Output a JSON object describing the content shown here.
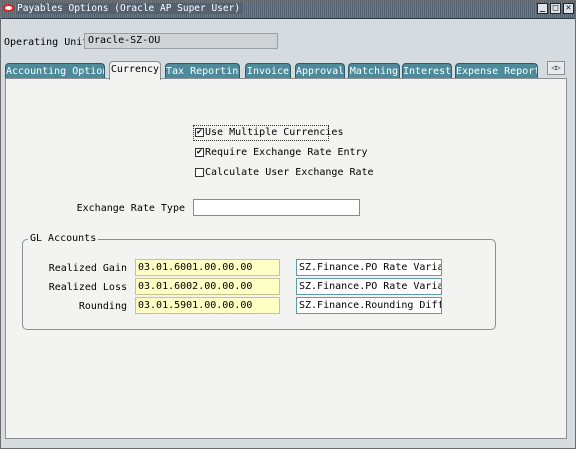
{
  "window": {
    "title": "Payables Options (Oracle AP Super User)",
    "buttons": [
      "_",
      "□",
      "✕"
    ]
  },
  "operating_unit": {
    "label": "Operating Unit",
    "value": "Oracle-SZ-OU"
  },
  "tabs": [
    {
      "label": "Accounting Option",
      "active": false
    },
    {
      "label": "Currency",
      "active": true
    },
    {
      "label": "Tax Reporting",
      "active": false
    },
    {
      "label": "Invoice",
      "active": false
    },
    {
      "label": "Approval",
      "active": false
    },
    {
      "label": "Matching",
      "active": false
    },
    {
      "label": "Interest",
      "active": false
    },
    {
      "label": "Expense Report",
      "active": false
    }
  ],
  "tab_scroll_icon": "◁▷",
  "options": {
    "use_multiple_currencies": {
      "label": "Use Multiple Currencies",
      "checked": true,
      "mark": "✔"
    },
    "require_exchange_rate_entry": {
      "label": "Require Exchange Rate Entry",
      "checked": true,
      "mark": "✔"
    },
    "calculate_user_exchange_rate": {
      "label": "Calculate User Exchange Rate",
      "checked": false,
      "mark": ""
    }
  },
  "exchange_rate_type": {
    "label": "Exchange Rate Type",
    "value": ""
  },
  "gl_accounts": {
    "title": "GL Accounts",
    "rows": [
      {
        "label": "Realized Gain",
        "account": "03.01.6001.00.00.00",
        "description": "SZ.Finance.PO Rate Variance"
      },
      {
        "label": "Realized Loss",
        "account": "03.01.6002.00.00.00",
        "description": "SZ.Finance.PO Rate Variance"
      },
      {
        "label": "Rounding",
        "account": "03.01.5901.00.00.00",
        "description": "SZ.Finance.Rounding Differe"
      }
    ]
  },
  "colors": {
    "tab_inactive": "#4d8b9b",
    "required_field": "#ffffc6",
    "panel": "#f3f4f2"
  }
}
